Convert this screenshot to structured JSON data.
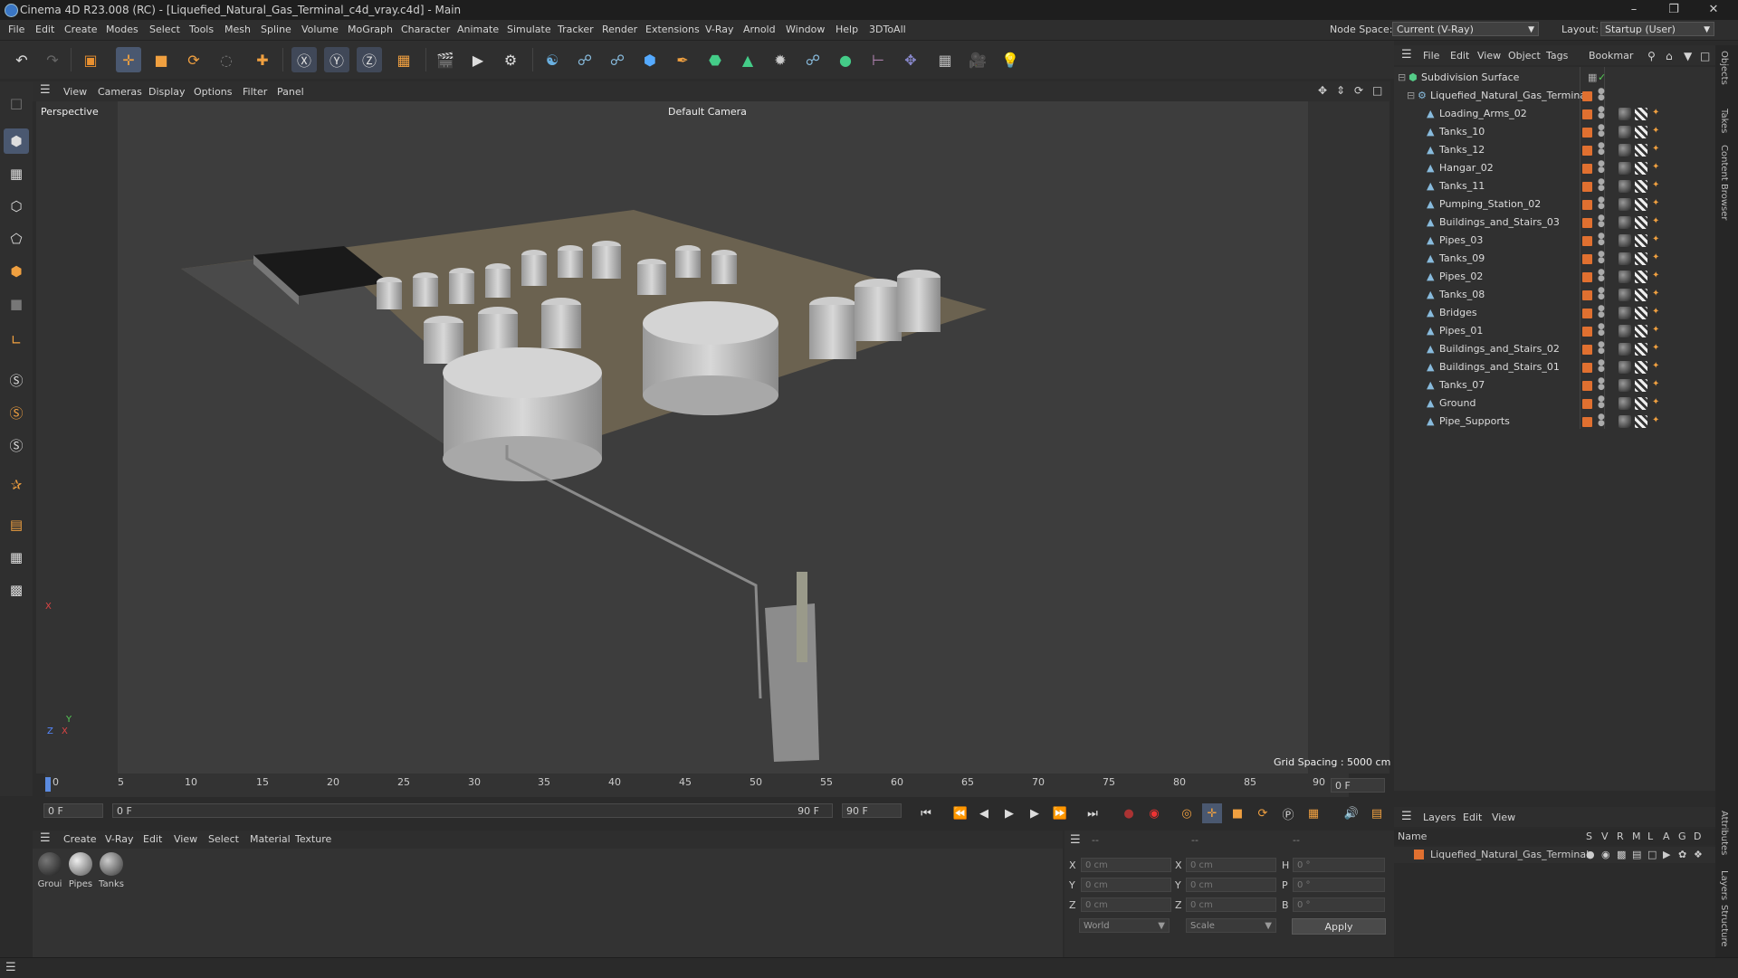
{
  "window": {
    "title": "Cinema 4D R23.008 (RC) - [Liquefied_Natural_Gas_Terminal_c4d_vray.c4d] - Main"
  },
  "menubar": {
    "items": [
      "File",
      "Edit",
      "Create",
      "Modes",
      "Select",
      "Tools",
      "Mesh",
      "Spline",
      "Volume",
      "MoGraph",
      "Character",
      "Animate",
      "Simulate",
      "Tracker",
      "Render",
      "Extensions",
      "V-Ray",
      "Arnold",
      "Window",
      "Help",
      "3DToAll"
    ],
    "node_space_label": "Node Space:",
    "node_space_value": "Current (V-Ray)",
    "layout_label": "Layout:",
    "layout_value": "Startup (User)"
  },
  "viewport": {
    "menu": [
      "View",
      "Cameras",
      "Display",
      "Options",
      "Filter",
      "Panel"
    ],
    "label": "Perspective",
    "camera": "Default Camera",
    "grid_spacing": "Grid Spacing : 5000 cm",
    "axes": {
      "x": "X",
      "y": "Y",
      "z": "Z"
    }
  },
  "timeline": {
    "ticks": [
      "0",
      "5",
      "10",
      "15",
      "20",
      "25",
      "30",
      "35",
      "40",
      "45",
      "50",
      "55",
      "60",
      "65",
      "70",
      "75",
      "80",
      "85",
      "90"
    ],
    "end_frame_field": "0 F",
    "current_frame": "0 F",
    "range_start": "0 F",
    "range_end": "90 F",
    "max_frame": "90 F"
  },
  "material_manager": {
    "menu": [
      "Create",
      "V-Ray",
      "Edit",
      "View",
      "Select",
      "Material",
      "Texture"
    ],
    "materials": [
      {
        "label": "Groui",
        "color": "#3a3a3a"
      },
      {
        "label": "Pipes",
        "color": "#8a8a8a"
      },
      {
        "label": "Tanks",
        "color": "#6d6d6d"
      }
    ]
  },
  "coordinates": {
    "header_left": "--",
    "header_mid": "--",
    "header_right": "--",
    "rows": [
      {
        "a": "X",
        "av": "0 cm",
        "b": "X",
        "bv": "0 cm",
        "c": "H",
        "cv": "0 °"
      },
      {
        "a": "Y",
        "av": "0 cm",
        "b": "Y",
        "bv": "0 cm",
        "c": "P",
        "cv": "0 °"
      },
      {
        "a": "Z",
        "av": "0 cm",
        "b": "Z",
        "bv": "0 cm",
        "c": "B",
        "cv": "0 °"
      }
    ],
    "mode": "World",
    "scale": "Scale",
    "apply": "Apply"
  },
  "object_manager": {
    "menu": [
      "File",
      "Edit",
      "View",
      "Object",
      "Tags",
      "Bookmar"
    ],
    "root": "Subdivision Surface",
    "group": "Liquefied_Natural_Gas_Terminal",
    "objects": [
      "Loading_Arms_02",
      "Tanks_10",
      "Tanks_12",
      "Hangar_02",
      "Tanks_11",
      "Pumping_Station_02",
      "Buildings_and_Stairs_03",
      "Pipes_03",
      "Tanks_09",
      "Pipes_02",
      "Tanks_08",
      "Bridges",
      "Pipes_01",
      "Buildings_and_Stairs_02",
      "Buildings_and_Stairs_01",
      "Tanks_07",
      "Ground",
      "Pipe_Supports"
    ]
  },
  "layer_manager": {
    "menu": [
      "Layers",
      "Edit",
      "View"
    ],
    "name_header": "Name",
    "columns": [
      "S",
      "V",
      "R",
      "M",
      "L",
      "A",
      "G",
      "D"
    ],
    "layer": "Liquefied_Natural_Gas_Terminal"
  },
  "side_tabs": [
    "Objects",
    "Takes",
    "Content Browser",
    "Attributes",
    "Layers",
    "Structure"
  ]
}
